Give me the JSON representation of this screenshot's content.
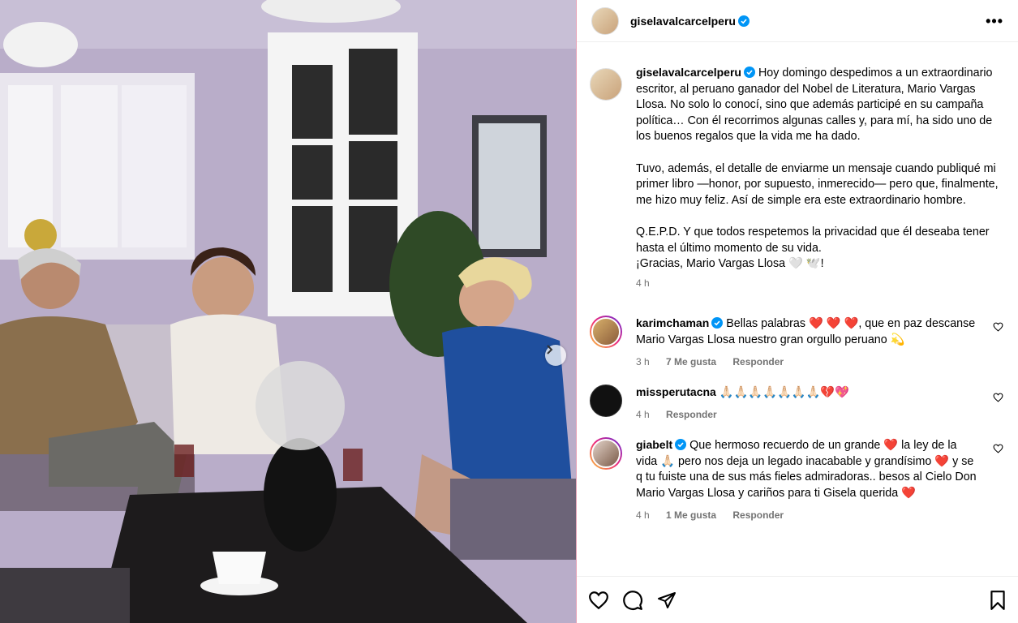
{
  "post": {
    "author": "giselavalcarcelperu",
    "more_label": "•••",
    "caption": {
      "p1": "Hoy domingo despedimos a un extraordinario escritor, al peruano ganador del Nobel de Literatura, Mario Vargas Llosa. No solo lo conocí, sino que además participé en su campaña política… Con él recorrimos algunas calles y, para mí, ha sido uno de los buenos regalos que la vida me ha dado.",
      "p2": "Tuvo, además, el detalle de enviarme un mensaje cuando publiqué mi primer libro —honor, por supuesto, inmerecido— pero que, finalmente, me hizo muy feliz. Así de simple era este extraordinario hombre.",
      "p3a": "Q.E.P.D. Y que todos respetemos la privacidad que él deseaba tener hasta el último momento de su vida.",
      "p3b": "¡Gracias, Mario Vargas Llosa 🤍 🕊️!",
      "time": "4 h"
    }
  },
  "comments": [
    {
      "user": "karimchaman",
      "verified": true,
      "text": "Bellas palabras ❤️ ❤️ ❤️, que en paz descanse Mario Vargas Llosa nuestro gran orgullo peruano 💫",
      "time": "3 h",
      "likes": "7 Me gusta",
      "reply": "Responder"
    },
    {
      "user": "missperutacna",
      "verified": false,
      "text": "🙏🏻🙏🏻🙏🏻🙏🏻🙏🏻🙏🏻🙏🏻💔💖",
      "time": "4 h",
      "reply": "Responder"
    },
    {
      "user": "giabelt",
      "verified": true,
      "text": "Que hermoso recuerdo de un grande ❤️ la ley de la vida 🙏🏻 pero nos deja un legado inacabable y grandísimo ❤️ y se q tu fuiste una de sus más fieles admiradoras.. besos al Cielo Don Mario Vargas Llosa y cariños para ti Gisela querida ❤️",
      "time": "4 h",
      "likes": "1 Me gusta",
      "reply": "Responder"
    }
  ],
  "icons": {
    "like": "heart-icon",
    "comment": "comment-icon",
    "share": "share-icon",
    "save": "bookmark-icon",
    "next": "chevron-right-icon",
    "verified": "verified-badge-icon"
  },
  "colors": {
    "verified": "#0095f6",
    "meta": "#737373",
    "wall": "#b3a6c4"
  }
}
